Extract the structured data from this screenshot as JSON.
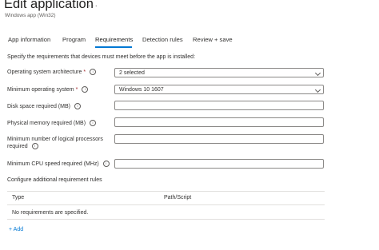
{
  "header": {
    "title": "Edit application",
    "more": "···",
    "subtitle": "Windows app (Win32)"
  },
  "tabs": [
    "App information",
    "Program",
    "Requirements",
    "Detection rules",
    "Review + save"
  ],
  "active_tab": "Requirements",
  "intro": "Specify the requirements that devices must meet before the app is installed:",
  "fields": {
    "os_arch": {
      "label": "Operating system architecture",
      "value": "2 selected"
    },
    "min_os": {
      "label": "Minimum operating system",
      "value": "Windows 10 1607"
    },
    "disk": {
      "label": "Disk space required (MB)",
      "value": ""
    },
    "memory": {
      "label": "Physical memory required (MB)",
      "value": ""
    },
    "processors": {
      "label": "Minimum number of logical processors required",
      "value": ""
    },
    "cpu": {
      "label": "Minimum CPU speed required (MHz)",
      "value": ""
    }
  },
  "additional": {
    "heading": "Configure additional requirement rules",
    "columns": [
      "Type",
      "Path/Script"
    ],
    "empty": "No requirements are specified.",
    "add_label": "+ Add"
  },
  "colors": {
    "accent": "#0078d4",
    "required": "#a4262c",
    "border": "#8a8886"
  }
}
